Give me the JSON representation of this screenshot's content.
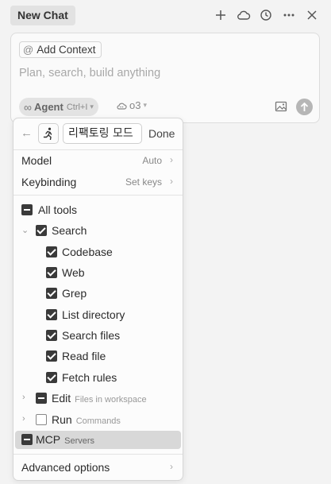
{
  "topbar": {
    "tab_label": "New Chat",
    "icons": [
      "plus-icon",
      "cloud-icon",
      "history-icon",
      "more-icon",
      "close-icon"
    ]
  },
  "composer": {
    "context_button": "Add Context",
    "placeholder": "Plan, search, build anything",
    "mode_label": "Agent",
    "mode_shortcut": "Ctrl+I",
    "model_label": "o3"
  },
  "panel": {
    "mode_name_value": "리팩토링 모드",
    "done_label": "Done",
    "settings": [
      {
        "label": "Model",
        "value": "Auto"
      },
      {
        "label": "Keybinding",
        "value": "Set keys"
      }
    ],
    "all_tools_label": "All tools",
    "search_label": "Search",
    "search_tools": [
      "Codebase",
      "Web",
      "Grep",
      "List directory",
      "Search files",
      "Read file",
      "Fetch rules"
    ],
    "edit_label": "Edit",
    "edit_sub": "Files in workspace",
    "run_label": "Run",
    "run_sub": "Commands",
    "mcp_label": "MCP",
    "mcp_sub": "Servers",
    "advanced_label": "Advanced options"
  },
  "colors": {
    "background": "#f3f3f3",
    "checkbox": "#3a3a3a",
    "highlight_row": "#d8d8d8"
  }
}
